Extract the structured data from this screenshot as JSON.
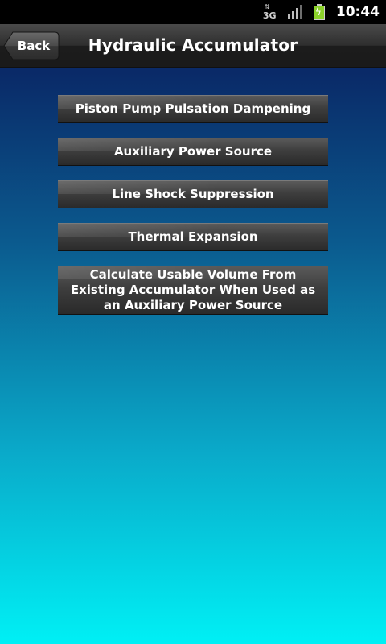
{
  "status_bar": {
    "network_label": "3G",
    "network_icon": "3g-data-icon",
    "signal_icon": "signal-strength-icon",
    "battery_icon": "battery-charging-icon",
    "time": "10:44"
  },
  "header": {
    "back_label": "Back",
    "title": "Hydraulic Accumulator"
  },
  "menu": {
    "items": [
      {
        "label": "Piston Pump Pulsation Dampening"
      },
      {
        "label": "Auxiliary Power Source"
      },
      {
        "label": "Line Shock Suppression"
      },
      {
        "label": "Thermal Expansion"
      },
      {
        "label": "Calculate Usable Volume From Existing Accumulator When Used as an Auxiliary Power Source"
      }
    ]
  },
  "colors": {
    "background_top": "#0a1f5c",
    "background_bottom": "#00f0f5",
    "button_face": "#3e3e3e",
    "title_bar": "#2e2e2e",
    "battery_fill": "#8bd12a"
  }
}
